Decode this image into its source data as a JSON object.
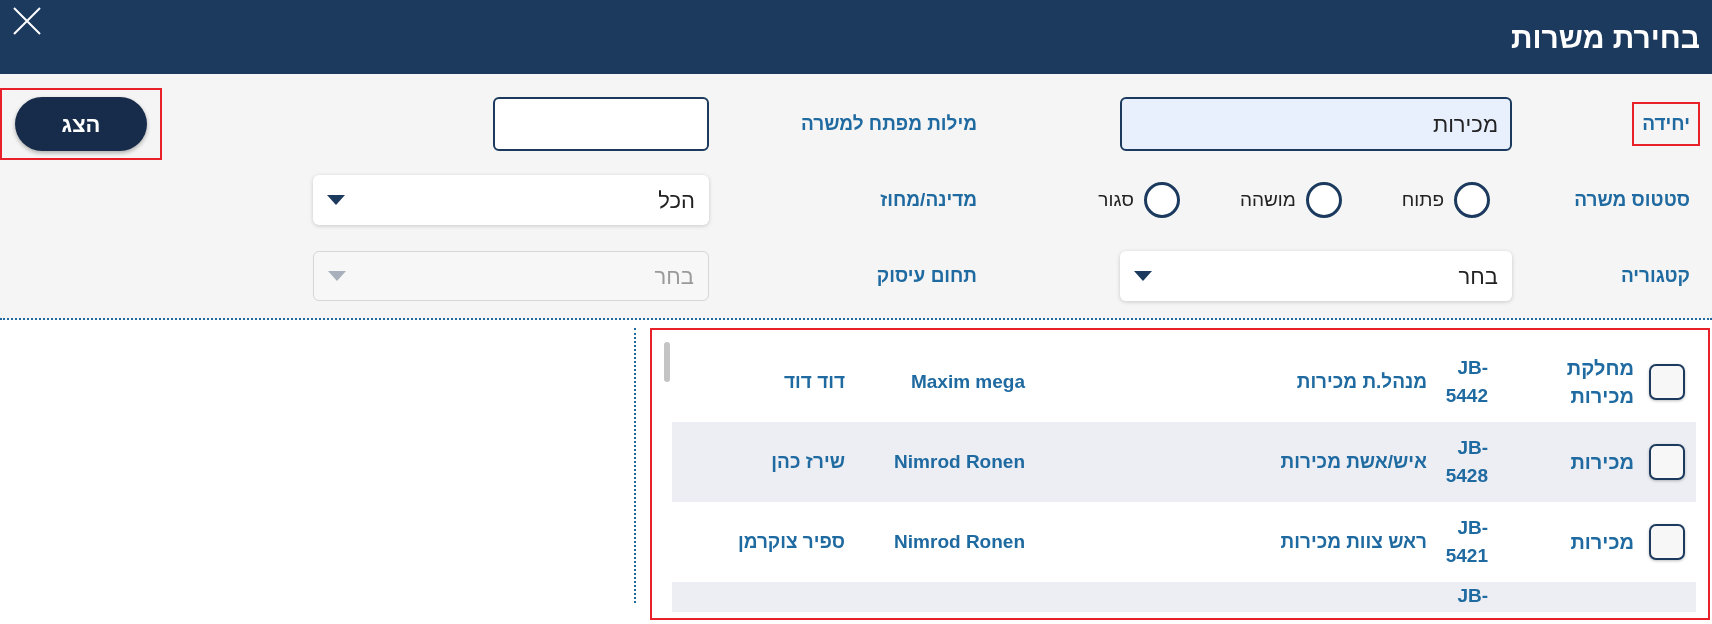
{
  "dialog": {
    "title": "בחירת משרות"
  },
  "unit": {
    "label": "יחידה",
    "value": "מכירות",
    "highlighted": true
  },
  "keywords": {
    "label": "מילות מפתח למשרה"
  },
  "show_button": {
    "label": "הצג",
    "highlighted": true
  },
  "status": {
    "label": "סטטוס משרה",
    "options": [
      {
        "label": "פתוח",
        "selected": false
      },
      {
        "label": "מושהה",
        "selected": false
      },
      {
        "label": "סגור",
        "selected": false
      }
    ]
  },
  "region": {
    "label": "מדינה/מחוז",
    "value": "הכל",
    "disabled": false
  },
  "category": {
    "label": "קטגוריה",
    "value": "בחר",
    "disabled": false
  },
  "field": {
    "label": "תחום עיסוק",
    "value": "בחר",
    "disabled": true
  },
  "table": {
    "highlighted": true,
    "rows": [
      {
        "checked": false,
        "department": "מחלקת מכירות",
        "code": "JB-5442",
        "title": "מנהל.ת מכירות",
        "manager": "Maxim mega",
        "name": "דוד דוד"
      },
      {
        "checked": false,
        "department": "מכירות",
        "code": "JB-5428",
        "title": "איש/אשת מכירות",
        "manager": "Nimrod Ronen",
        "name": "שירז כהן"
      },
      {
        "checked": false,
        "department": "מכירות",
        "code": "JB-5421",
        "title": "ראש צוות מכירות",
        "manager": "Nimrod Ronen",
        "name": "ספיר צוקרמן"
      },
      {
        "code": "JB-"
      }
    ]
  }
}
